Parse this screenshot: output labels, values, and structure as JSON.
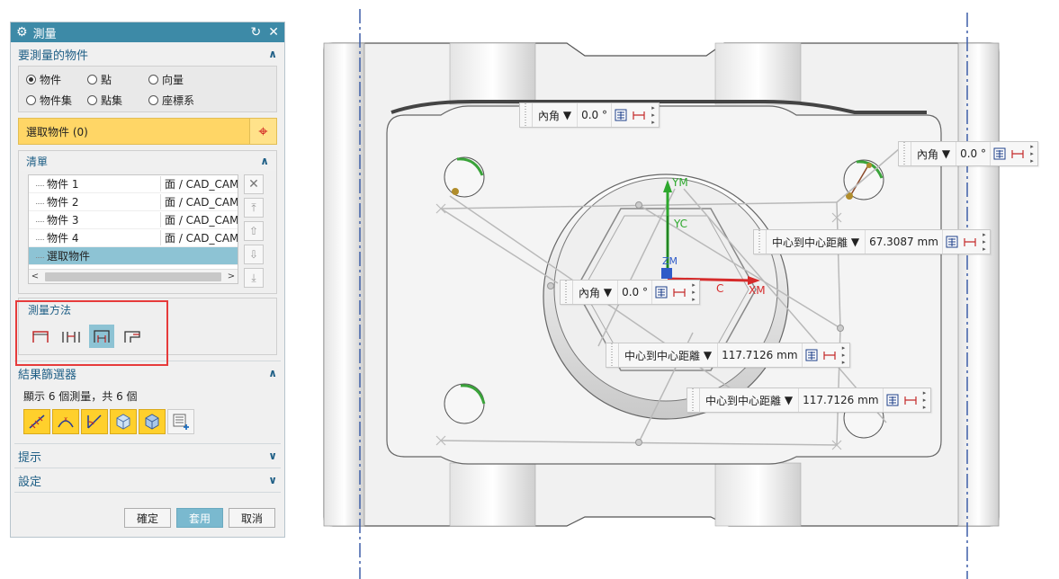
{
  "dialog": {
    "title": "測量",
    "sections": {
      "objects": {
        "title": "要測量的物件",
        "radios": [
          {
            "label": "物件",
            "checked": true
          },
          {
            "label": "點",
            "checked": false
          },
          {
            "label": "向量",
            "checked": false
          },
          {
            "label": "物件集",
            "checked": false
          },
          {
            "label": "點集",
            "checked": false
          },
          {
            "label": "座標系",
            "checked": false
          }
        ],
        "select_label": "選取物件 (0)"
      },
      "list": {
        "title": "清單",
        "rows": [
          {
            "name": "物件 1",
            "type": "面 / CAD_CAM"
          },
          {
            "name": "物件 2",
            "type": "面 / CAD_CAM"
          },
          {
            "name": "物件 3",
            "type": "面 / CAD_CAM"
          },
          {
            "name": "物件 4",
            "type": "面 / CAD_CAM"
          },
          {
            "name": "選取物件",
            "type": ""
          }
        ]
      },
      "method": {
        "title": "測量方法"
      },
      "filter": {
        "title": "結果篩選器",
        "summary": "顯示 6 個測量，共 6 個"
      },
      "hint": {
        "title": "提示"
      },
      "settings": {
        "title": "設定"
      }
    },
    "buttons": {
      "ok": "確定",
      "apply": "套用",
      "cancel": "取消"
    }
  },
  "viewport": {
    "axes": {
      "ym": "YM",
      "yc": "YC",
      "zm": "ZM",
      "c": "C",
      "xm": "XM"
    },
    "tags": [
      {
        "field": "內角",
        "value": "0.0",
        "unit": "°"
      },
      {
        "field": "內角",
        "value": "0.0",
        "unit": "°"
      },
      {
        "field": "中心到中心距離",
        "value": "67.3087",
        "unit": "mm"
      },
      {
        "field": "內角",
        "value": "0.0",
        "unit": "°"
      },
      {
        "field": "中心到中心距離",
        "value": "117.7126",
        "unit": "mm"
      },
      {
        "field": "中心到中心距離",
        "value": "117.7126",
        "unit": "mm"
      }
    ]
  },
  "colors": {
    "accent": "#3d8aa7",
    "selection": "#8dc3d4",
    "highlight": "#ffd666",
    "frame": "#e63b3b"
  }
}
